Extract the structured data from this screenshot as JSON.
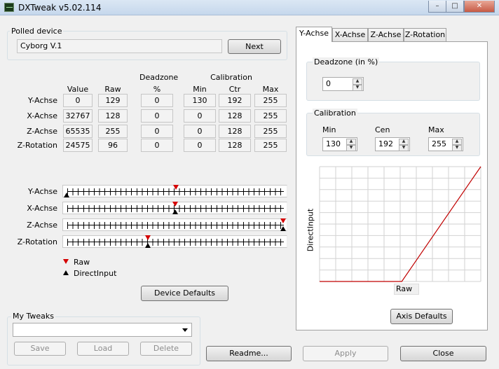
{
  "window": {
    "title": "DXTweak v5.02.114",
    "minimize_glyph": "–",
    "maximize_glyph": "□",
    "close_glyph": "✕"
  },
  "polled": {
    "group_label": "Polled device",
    "device_name": "Cyborg V.1",
    "next_label": "Next"
  },
  "table": {
    "header_deadzone": "Deadzone",
    "header_calibration": "Calibration",
    "columns": [
      "Value",
      "Raw",
      "%",
      "Min",
      "Ctr",
      "Max"
    ],
    "rows": [
      {
        "name": "Y-Achse",
        "cells": [
          "0",
          "129",
          "0",
          "130",
          "192",
          "255"
        ]
      },
      {
        "name": "X-Achse",
        "cells": [
          "32767",
          "128",
          "0",
          "0",
          "128",
          "255"
        ]
      },
      {
        "name": "Z-Achse",
        "cells": [
          "65535",
          "255",
          "0",
          "0",
          "128",
          "255"
        ]
      },
      {
        "name": "Z-Rotation",
        "cells": [
          "24575",
          "96",
          "0",
          "0",
          "128",
          "255"
        ]
      }
    ]
  },
  "sliders": [
    {
      "name": "Y-Achse",
      "raw": 129,
      "direct": 0
    },
    {
      "name": "X-Achse",
      "raw": 128,
      "direct": 128
    },
    {
      "name": "Z-Achse",
      "raw": 255,
      "direct": 255
    },
    {
      "name": "Z-Rotation",
      "raw": 96,
      "direct": 96
    }
  ],
  "legend": {
    "raw_label": "Raw",
    "direct_label": "DirectInput"
  },
  "device_defaults_label": "Device Defaults",
  "tweaks": {
    "group_label": "My Tweaks",
    "selected": "",
    "save_label": "Save",
    "load_label": "Load",
    "delete_label": "Delete"
  },
  "tabs": [
    "Y-Achse",
    "X-Achse",
    "Z-Achse",
    "Z-Rotation"
  ],
  "active_tab": "Y-Achse",
  "deadzone": {
    "group_label": "Deadzone (in %)",
    "value": "0"
  },
  "calibration": {
    "group_label": "Calibration",
    "min_label": "Min",
    "cen_label": "Cen",
    "max_label": "Max",
    "min": "130",
    "cen": "192",
    "max": "255"
  },
  "plot": {
    "xlabel": "Raw",
    "ylabel": "DirectInput",
    "line_color": "#c00000"
  },
  "chart_data": {
    "type": "line",
    "xlabel": "Raw",
    "ylabel": "DirectInput",
    "xlim": [
      0,
      255
    ],
    "ylim": [
      0,
      255
    ],
    "grid": true,
    "series": [
      {
        "x": [
          0,
          130,
          255
        ],
        "y": [
          0,
          0,
          255
        ]
      }
    ]
  },
  "axis_defaults_label": "Axis Defaults",
  "bottom": {
    "readme_label": "Readme...",
    "apply_label": "Apply",
    "close_label": "Close"
  }
}
